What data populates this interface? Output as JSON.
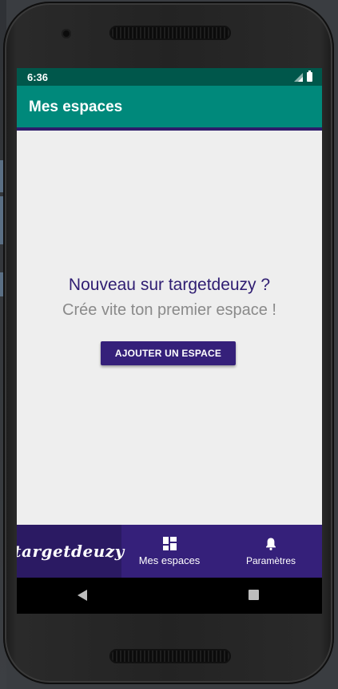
{
  "status_bar": {
    "time": "6:36",
    "icons": [
      "signal-icon",
      "battery-icon"
    ],
    "color": "#00574b"
  },
  "app_bar": {
    "title": "Mes espaces",
    "color": "#00897b",
    "accent_line_color": "#2e1d6b"
  },
  "main": {
    "welcome_title": "Nouveau sur targetdeuzy ?",
    "welcome_subtitle": "Crée vite ton premier espace !",
    "add_button_label": "AJOUTER UN ESPACE",
    "button_color": "#35207a",
    "background": "#eeeeee"
  },
  "bottom_nav": {
    "brand": "targetdeuzy",
    "items": [
      {
        "label": "Mes espaces",
        "icon": "dashboard-grid-icon"
      },
      {
        "label": "Paramètres",
        "icon": "bell-icon"
      }
    ],
    "color": "#35207a"
  },
  "system_nav": {
    "icons": [
      "back-icon",
      "recents-icon"
    ]
  }
}
